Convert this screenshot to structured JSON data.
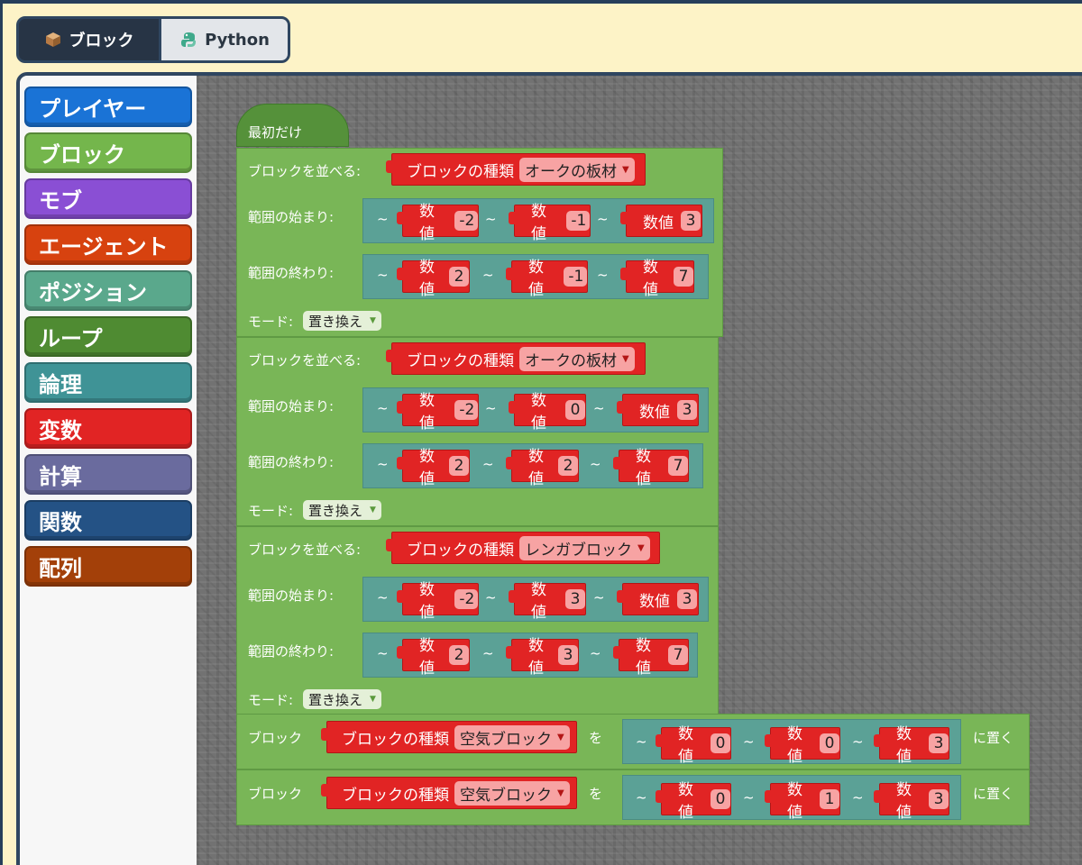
{
  "tabs": [
    {
      "label": "ブロック",
      "icon": "cube-icon",
      "active": true
    },
    {
      "label": "Python",
      "icon": "python-icon",
      "active": false
    }
  ],
  "categories": [
    {
      "label": "プレイヤー",
      "color": "#1a73d6"
    },
    {
      "label": "ブロック",
      "color": "#74b64c"
    },
    {
      "label": "モブ",
      "color": "#8a4fd4"
    },
    {
      "label": "エージェント",
      "color": "#d7420f"
    },
    {
      "label": "ポジション",
      "color": "#5aa88c"
    },
    {
      "label": "ループ",
      "color": "#4f8b32"
    },
    {
      "label": "論理",
      "color": "#3f9396"
    },
    {
      "label": "変数",
      "color": "#e12424"
    },
    {
      "label": "計算",
      "color": "#6a6b9e"
    },
    {
      "label": "関数",
      "color": "#245285"
    },
    {
      "label": "配列",
      "color": "#a34009"
    }
  ],
  "hat_label": "最初だけ",
  "labels": {
    "fill": "ブロックを並べる:",
    "from": "範囲の始まり:",
    "to": "範囲の終わり:",
    "mode": "モード:",
    "num": "数値",
    "block_type": "ブロックの種類",
    "tilde": "~",
    "place_prefix": "ブロック",
    "place_wo": "を",
    "place_suffix": "に置く"
  },
  "fills": [
    {
      "block": "オークの板材",
      "from": [
        "-2",
        "-1",
        "3"
      ],
      "to": [
        "2",
        "-1",
        "7"
      ],
      "mode": "置き換え"
    },
    {
      "block": "オークの板材",
      "from": [
        "-2",
        "0",
        "3"
      ],
      "to": [
        "2",
        "2",
        "7"
      ],
      "mode": "置き換え"
    },
    {
      "block": "レンガブロック",
      "from": [
        "-2",
        "3",
        "3"
      ],
      "to": [
        "2",
        "3",
        "7"
      ],
      "mode": "置き換え"
    }
  ],
  "places": [
    {
      "block": "空気ブロック",
      "pos": [
        "0",
        "0",
        "3"
      ]
    },
    {
      "block": "空気ブロック",
      "pos": [
        "0",
        "1",
        "3"
      ]
    }
  ]
}
